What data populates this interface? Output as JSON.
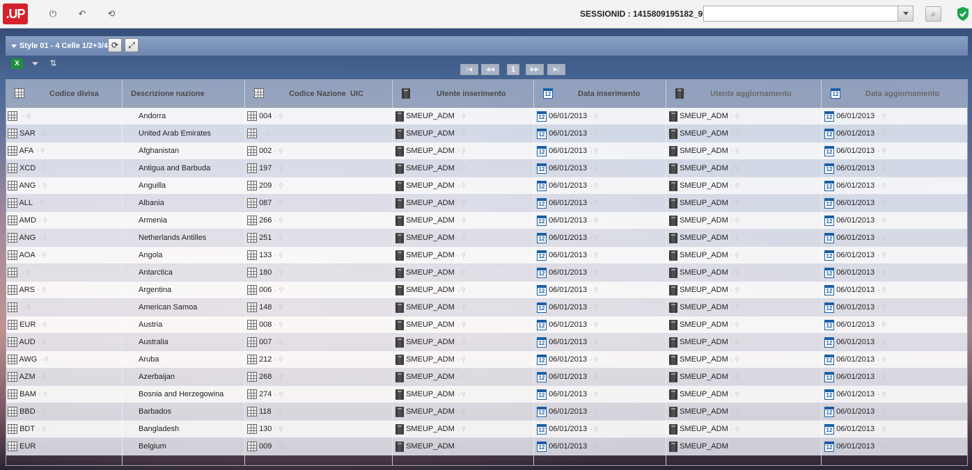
{
  "topbar": {
    "logo": ".UP",
    "session_label": "SESSIONID : 1415809195182_9",
    "session_input_value": "",
    "icons": [
      "power-icon",
      "back-icon",
      "refresh-icon",
      "search-icon",
      "shield-check-icon"
    ]
  },
  "panel": {
    "title": "Style 01 - 4 Celle 1/2+3/4",
    "refresh_icon": "refresh-icon",
    "fullscreen_icon": "fullscreen-icon"
  },
  "toolbar": {
    "icons": [
      "excel-export-icon",
      "filter-add-icon",
      "sort-icon"
    ]
  },
  "pager": {
    "first": "|◀",
    "prev": "◀◀",
    "current_page": "1",
    "next": "▶▶",
    "last": "▶|"
  },
  "grid": {
    "columns": [
      {
        "label": "Codice divisa",
        "icon": "table-icon"
      },
      {
        "label": "Descrizione nazione",
        "icon": ""
      },
      {
        "label": "Codice Nazione  UIC",
        "icon": "table-icon"
      },
      {
        "label": "Utente inserimento",
        "icon": "user-icon"
      },
      {
        "label": "Data inserimento",
        "icon": "calendar-icon"
      },
      {
        "label": "Utente aggiornamento",
        "icon": "user-icon"
      },
      {
        "label": "Data aggiornamento",
        "icon": "calendar-icon"
      }
    ],
    "calendar_glyph": "12",
    "rows": [
      {
        "code": "",
        "country": "Andorra",
        "uic": "004",
        "user_ins": "SMEUP_ADM",
        "date_ins": "06/01/2013",
        "user_upd": "SMEUP_ADM",
        "date_upd": "06/01/2013"
      },
      {
        "code": "SAR",
        "country": "United Arab Emirates",
        "uic": "",
        "user_ins": "SMEUP_ADM",
        "date_ins": "06/01/2013",
        "user_upd": "SMEUP_ADM",
        "date_upd": "06/01/2013"
      },
      {
        "code": "AFA",
        "country": "Afghanistan",
        "uic": "002",
        "user_ins": "SMEUP_ADM",
        "date_ins": "06/01/2013",
        "user_upd": "SMEUP_ADM",
        "date_upd": "06/01/2013"
      },
      {
        "code": "XCD",
        "country": "Antigua and Barbuda",
        "uic": "197",
        "user_ins": "SMEUP_ADM",
        "date_ins": "06/01/2013",
        "user_upd": "SMEUP_ADM",
        "date_upd": "06/01/2013"
      },
      {
        "code": "ANG",
        "country": "Anguilla",
        "uic": "209",
        "user_ins": "SMEUP_ADM",
        "date_ins": "06/01/2013",
        "user_upd": "SMEUP_ADM",
        "date_upd": "06/01/2013"
      },
      {
        "code": "ALL",
        "country": "Albania",
        "uic": "087",
        "user_ins": "SMEUP_ADM",
        "date_ins": "06/01/2013",
        "user_upd": "SMEUP_ADM",
        "date_upd": "06/01/2013"
      },
      {
        "code": "AMD",
        "country": "Armenia",
        "uic": "266",
        "user_ins": "SMEUP_ADM",
        "date_ins": "06/01/2013",
        "user_upd": "SMEUP_ADM",
        "date_upd": "06/01/2013"
      },
      {
        "code": "ANG",
        "country": "Netherlands Antilles",
        "uic": "251",
        "user_ins": "SMEUP_ADM",
        "date_ins": "06/01/2013",
        "user_upd": "SMEUP_ADM",
        "date_upd": "06/01/2013"
      },
      {
        "code": "AOA",
        "country": "Angola",
        "uic": "133",
        "user_ins": "SMEUP_ADM",
        "date_ins": "06/01/2013",
        "user_upd": "SMEUP_ADM",
        "date_upd": "06/01/2013"
      },
      {
        "code": "",
        "country": "Antarctica",
        "uic": "180",
        "user_ins": "SMEUP_ADM",
        "date_ins": "06/01/2013",
        "user_upd": "SMEUP_ADM",
        "date_upd": "06/01/2013"
      },
      {
        "code": "ARS",
        "country": "Argentina",
        "uic": "006",
        "user_ins": "SMEUP_ADM",
        "date_ins": "06/01/2013",
        "user_upd": "SMEUP_ADM",
        "date_upd": "06/01/2013"
      },
      {
        "code": "",
        "country": "American Samoa",
        "uic": "148",
        "user_ins": "SMEUP_ADM",
        "date_ins": "06/01/2013",
        "user_upd": "SMEUP_ADM",
        "date_upd": "06/01/2013"
      },
      {
        "code": "EUR",
        "country": "Austria",
        "uic": "008",
        "user_ins": "SMEUP_ADM",
        "date_ins": "06/01/2013",
        "user_upd": "SMEUP_ADM",
        "date_upd": "06/01/2013"
      },
      {
        "code": "AUD",
        "country": "Australia",
        "uic": "007",
        "user_ins": "SMEUP_ADM",
        "date_ins": "06/01/2013",
        "user_upd": "SMEUP_ADM",
        "date_upd": "06/01/2013"
      },
      {
        "code": "AWG",
        "country": "Aruba",
        "uic": "212",
        "user_ins": "SMEUP_ADM",
        "date_ins": "06/01/2013",
        "user_upd": "SMEUP_ADM",
        "date_upd": "06/01/2013"
      },
      {
        "code": "AZM",
        "country": "Azerbaijan",
        "uic": "268",
        "user_ins": "SMEUP_ADM",
        "date_ins": "06/01/2013",
        "user_upd": "SMEUP_ADM",
        "date_upd": "06/01/2013"
      },
      {
        "code": "BAM",
        "country": "Bosnia and Herzegowina",
        "uic": "274",
        "user_ins": "SMEUP_ADM",
        "date_ins": "06/01/2013",
        "user_upd": "SMEUP_ADM",
        "date_upd": "06/01/2013"
      },
      {
        "code": "BBD",
        "country": "Barbados",
        "uic": "118",
        "user_ins": "SMEUP_ADM",
        "date_ins": "06/01/2013",
        "user_upd": "SMEUP_ADM",
        "date_upd": "06/01/2013"
      },
      {
        "code": "BDT",
        "country": "Bangladesh",
        "uic": "130",
        "user_ins": "SMEUP_ADM",
        "date_ins": "06/01/2013",
        "user_upd": "SMEUP_ADM",
        "date_upd": "06/01/2013"
      },
      {
        "code": "EUR",
        "country": "Belgium",
        "uic": "009",
        "user_ins": "SMEUP_ADM",
        "date_ins": "06/01/2013",
        "user_upd": "SMEUP_ADM",
        "date_upd": "06/01/2013"
      }
    ]
  }
}
